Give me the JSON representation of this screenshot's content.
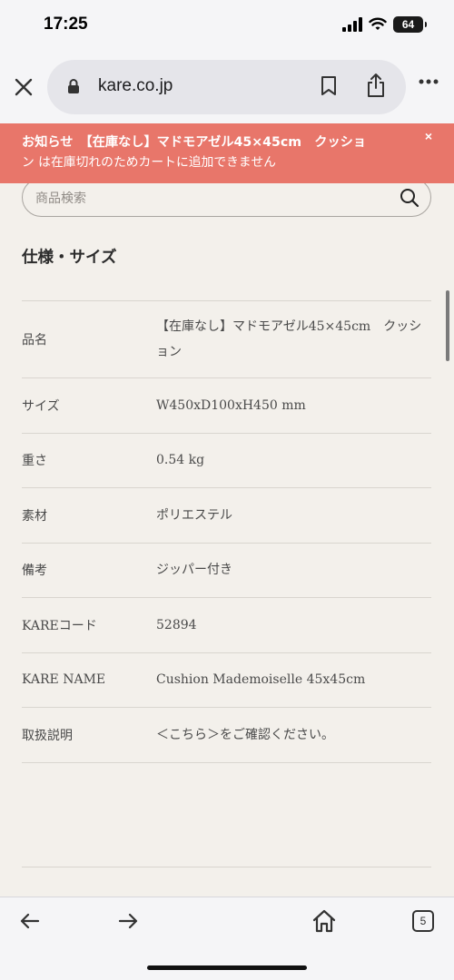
{
  "status_bar": {
    "time": "17:25",
    "battery": "64"
  },
  "browser": {
    "url": "kare.co.jp",
    "tab_count": "5"
  },
  "alert": {
    "line1": "お知らせ　【在庫なし】マドモアゼル45×45cm　クッショ",
    "line2": "ン は在庫切れのためカートに追加できません",
    "close": "×"
  },
  "search": {
    "placeholder": "商品検索"
  },
  "section_title": "仕様・サイズ",
  "specs": [
    {
      "label": "品名",
      "value": "【在庫なし】マドモアゼル45×45cm　クッション"
    },
    {
      "label": "サイズ",
      "value": "W450xD100xH450 mm"
    },
    {
      "label": "重さ",
      "value": "0.54 kg"
    },
    {
      "label": "素材",
      "value": "ポリエステル"
    },
    {
      "label": "備考",
      "value": "ジッパー付き"
    },
    {
      "label": "KAREコード",
      "value": "52894"
    },
    {
      "label": "KARE NAME",
      "value": "Cushion Mademoiselle 45x45cm"
    },
    {
      "label": "取扱説明",
      "value": "＜こちら＞をご確認ください。"
    }
  ],
  "icons": [
    "close-icon",
    "lock-icon",
    "bookmark-icon",
    "share-icon",
    "more-icon",
    "search-icon",
    "back-icon",
    "forward-icon",
    "home-icon",
    "tabs-icon"
  ]
}
